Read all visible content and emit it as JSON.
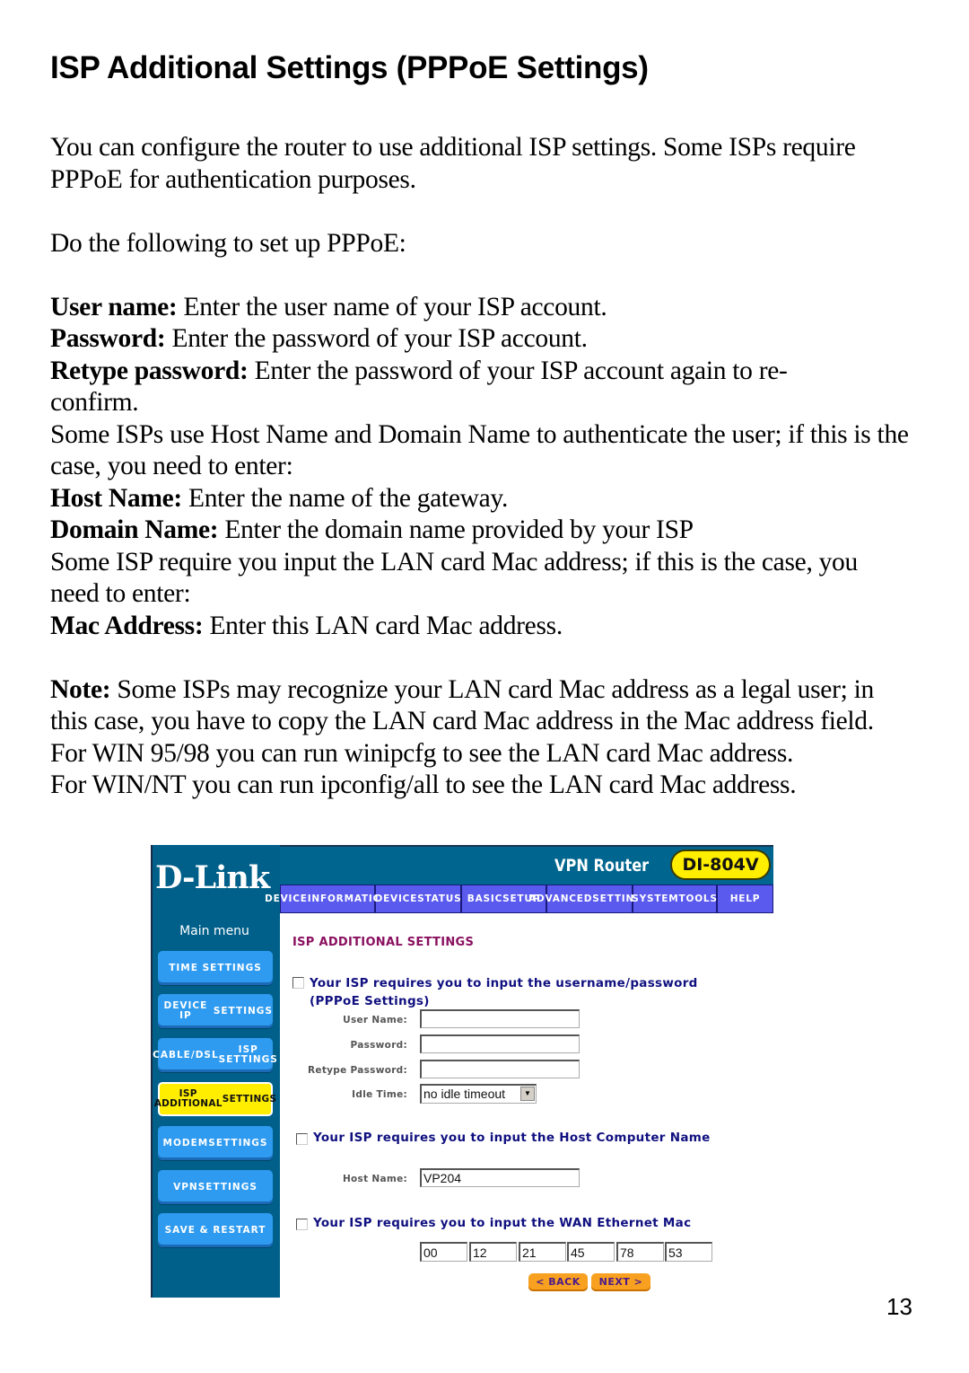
{
  "document": {
    "title": "ISP Additional Settings (PPPoE Settings)",
    "intro": "You can configure the router to use additional ISP settings. Some ISPs require PPPoE for authentication purposes.",
    "steps_heading": "Do the following to set up PPPoE:",
    "definitions": [
      {
        "term": "User name:",
        "text": " Enter the user name of your ISP account."
      },
      {
        "term": "Password:",
        "text": " Enter the password of your ISP account."
      },
      {
        "term": "Retype password:",
        "text": " Enter the password of your ISP account again to re-confirm."
      }
    ],
    "host_domain_intro": "Some ISPs use Host Name and Domain Name to authenticate the user; if this is the case, you need to enter:",
    "host_name": {
      "term": "Host Name:",
      "text": " Enter the name of the gateway."
    },
    "domain_name": {
      "term": "Domain Name:",
      "text": " Enter the domain name provided by your ISP"
    },
    "mac_intro": "Some ISP require you input the LAN card Mac address; if this is the case, you need to enter:",
    "mac_address": {
      "term": "Mac Address:",
      "text": " Enter this LAN card Mac address."
    },
    "note": {
      "term": "Note:",
      "text": " Some ISPs may recognize your LAN card Mac address as a legal user; in this case, you have to copy the LAN card Mac address in the Mac address field."
    },
    "win9x": "For WIN 95/98 you can run winipcfg to see the LAN card Mac address.",
    "winnt": "For WIN/NT you can run ipconfig/all to see the LAN card Mac address.",
    "page_number": "13"
  },
  "router": {
    "logo": "D-Link",
    "product_name": "VPN Router",
    "model": "DI-804V",
    "tabs": [
      {
        "line1": "DEVICE",
        "line2": "INFORMATION"
      },
      {
        "line1": "DEVICE",
        "line2": "STATUS"
      },
      {
        "line1": "BASIC",
        "line2": "SETUP"
      },
      {
        "line1": "ADVANCED",
        "line2": "SETTINGS"
      },
      {
        "line1": "SYSTEM",
        "line2": "TOOLS"
      },
      {
        "line1": "HELP",
        "line2": ""
      }
    ],
    "main_menu_label": "Main menu",
    "menu": [
      {
        "line1": "TIME SETTINGS",
        "line2": ""
      },
      {
        "line1": "DEVICE IP",
        "line2": "SETTINGS"
      },
      {
        "line1": "CABLE/DSL",
        "line2": "ISP SETTINGS"
      },
      {
        "line1": "ISP ADDITIONAL",
        "line2": "SETTINGS"
      },
      {
        "line1": "MODEM",
        "line2": "SETTINGS"
      },
      {
        "line1": "VPN",
        "line2": "SETTINGS"
      },
      {
        "line1": "SAVE & RESTART",
        "line2": ""
      }
    ],
    "active_menu_index": 3,
    "section_title": "ISP ADDITIONAL SETTINGS",
    "pppoe_checkbox": {
      "label": "Your ISP requires you to input the username/password (PPPoE Settings)",
      "checked": false
    },
    "user_name": {
      "label": "User Name:",
      "value": ""
    },
    "password": {
      "label": "Password:",
      "value": ""
    },
    "retype_password": {
      "label": "Retype Password:",
      "value": ""
    },
    "idle_time": {
      "label": "Idle Time:",
      "value": "no idle timeout"
    },
    "host_checkbox": {
      "label": "Your ISP requires you to input the Host Computer Name",
      "checked": false
    },
    "host_name": {
      "label": "Host Name:",
      "value": "VP204"
    },
    "mac_checkbox": {
      "label": "Your ISP requires you to input the WAN Ethernet Mac",
      "checked": false
    },
    "mac_octets": [
      "00",
      "12",
      "21",
      "45",
      "78",
      "53"
    ],
    "back_button": "< BACK",
    "next_button": "NEXT >"
  },
  "colors": {
    "router_header": "#00668f",
    "tab_blue": "#5a5aee",
    "menu_button": "#2f9bf0",
    "active_menu": "#ffee00",
    "section_title": "#8a1060",
    "checkbox_label": "#101080",
    "nav_button": "#f8a020"
  }
}
